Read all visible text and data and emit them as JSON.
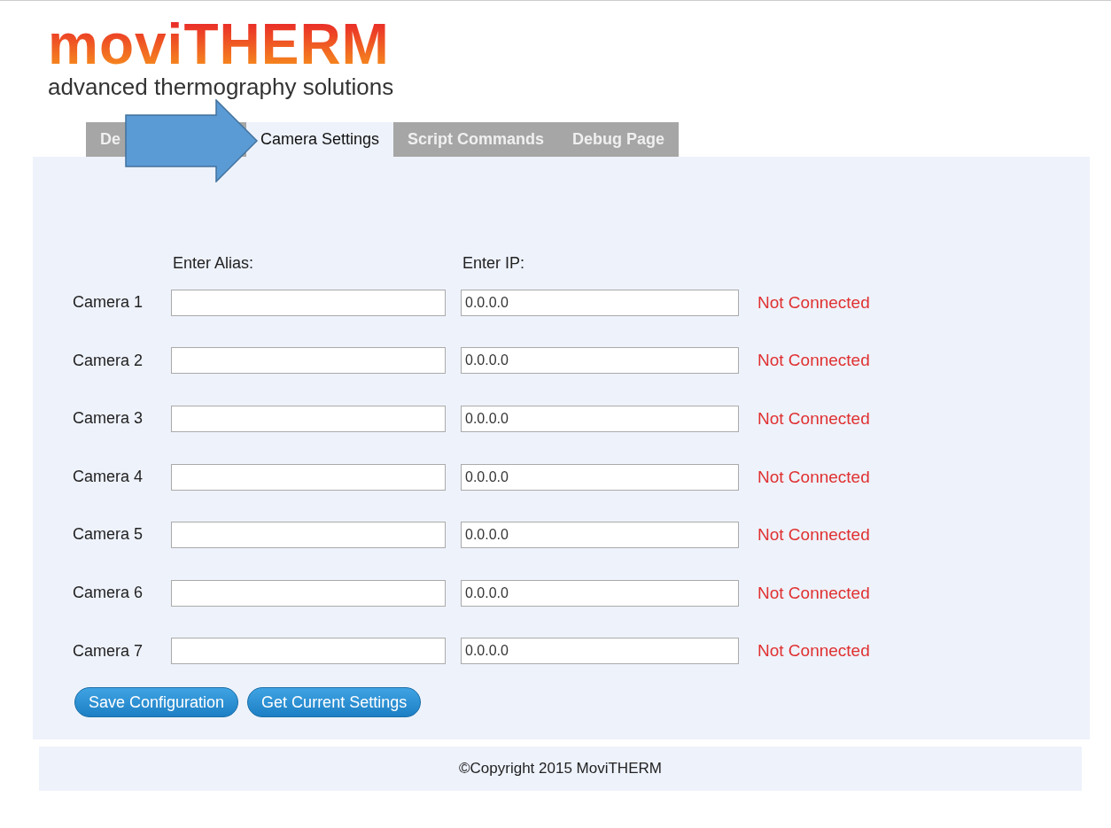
{
  "logo": {
    "wordmark": "moviTHERM",
    "tagline": "advanced thermography solutions"
  },
  "tabs": [
    {
      "label": "De",
      "selected": false
    },
    {
      "label": "Camera Settings",
      "selected": true
    },
    {
      "label": "Script Commands",
      "selected": false
    },
    {
      "label": "Debug Page",
      "selected": false
    }
  ],
  "headers": {
    "alias": "Enter Alias:",
    "ip": "Enter IP:"
  },
  "cameras": [
    {
      "name": "Camera 1",
      "ip": "0.0.0.0",
      "status": "Not Connected",
      "connected": false
    },
    {
      "name": "Camera 2",
      "ip": "0.0.0.0",
      "status": "Not Connected",
      "connected": false
    },
    {
      "name": "Camera 3",
      "ip": "0.0.0.0",
      "status": "Not Connected",
      "connected": false
    },
    {
      "name": "Camera 4",
      "ip": "0.0.0.0",
      "status": "Not Connected",
      "connected": false
    },
    {
      "name": "Camera 5",
      "ip": "0.0.0.0",
      "status": "Not Connected",
      "connected": false
    },
    {
      "name": "Camera 6",
      "ip": "0.0.0.0",
      "status": "Not Connected",
      "connected": false
    },
    {
      "name": "Camera 7",
      "ip": "0.0.0.0",
      "status": "Not Connected",
      "connected": false
    }
  ],
  "buttons": [
    "Save Configuration",
    "Get Current Settings"
  ],
  "footer": "©Copyright 2015 MoviTHERM"
}
